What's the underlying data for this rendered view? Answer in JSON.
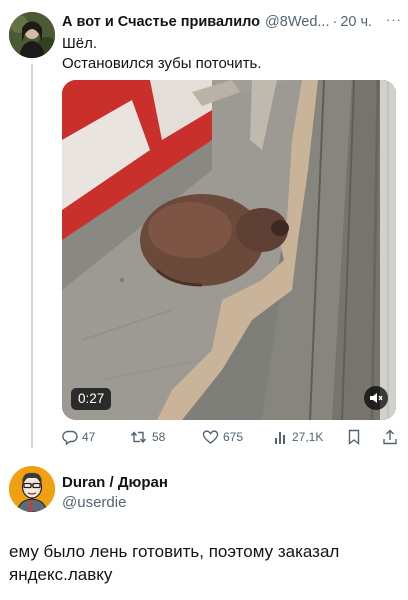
{
  "tweet": {
    "author_name": "А вот и Счастье привалило",
    "handle": "@8Wed...",
    "separator": "·",
    "time": "20 ч.",
    "more_label": "···",
    "text_line1": "Шёл.",
    "text_line2": "Остановился зубы поточить.",
    "video": {
      "duration": "0:27",
      "mute_icon": "speaker-muted-icon"
    },
    "actions": {
      "replies": "47",
      "retweets": "58",
      "likes": "675",
      "views": "27,1K",
      "reply_icon": "reply-icon",
      "retweet_icon": "retweet-icon",
      "like_icon": "heart-icon",
      "views_icon": "views-chart-icon",
      "bookmark_icon": "bookmark-icon",
      "share_icon": "share-icon"
    }
  },
  "reply": {
    "author_name": "Duran / Дюран",
    "handle": "@userdie",
    "text": "ему было лень готовить, поэтому заказал яндекс.лавку"
  },
  "colors": {
    "text_primary": "#0f1419",
    "text_secondary": "#536471",
    "thread_line": "#cfd9de",
    "avatar2_bg": "#f2a012"
  }
}
